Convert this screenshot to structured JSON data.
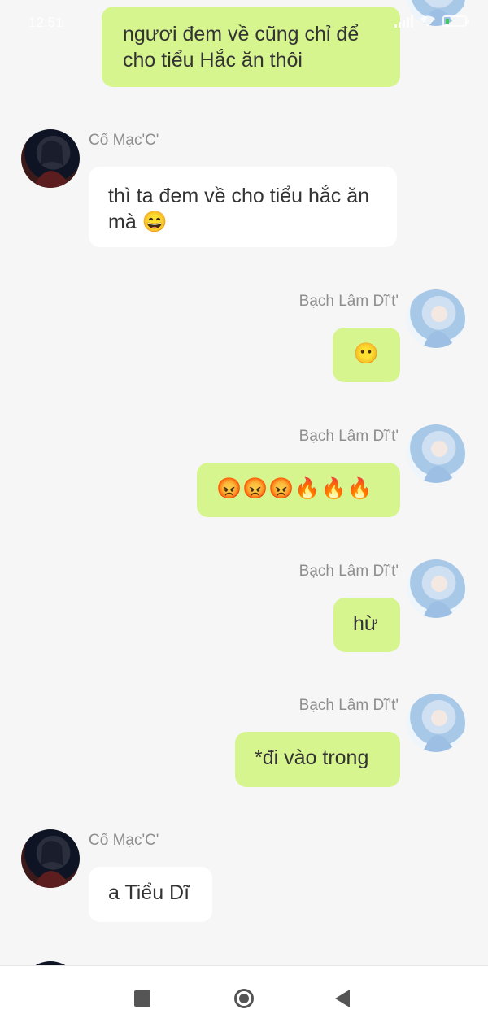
{
  "status_bar": {
    "time": "12:51",
    "icons": [
      "signal-icon",
      "wifi-icon",
      "battery-icon"
    ]
  },
  "participants": {
    "other": {
      "name": "Cố Mạc'C'",
      "avatar": "dark-haired-character-avatar"
    },
    "me": {
      "name": "Bạch Lâm Dĩ't'",
      "avatar": "white-haired-character-avatar"
    }
  },
  "messages": [
    {
      "from": "me",
      "show_name": false,
      "text": "ngươi đem về cũng chỉ để cho tiểu Hắc ăn thôi"
    },
    {
      "from": "other",
      "name": "Cố Mạc'C'",
      "text": "thì ta đem về cho tiểu hắc ăn mà 😄"
    },
    {
      "from": "me",
      "name": "Bạch Lâm Dĩ't'",
      "text": "😶"
    },
    {
      "from": "me",
      "name": "Bạch Lâm Dĩ't'",
      "text": "😡😡😡🔥🔥🔥"
    },
    {
      "from": "me",
      "name": "Bạch Lâm Dĩ't'",
      "text": "hừ"
    },
    {
      "from": "me",
      "name": "Bạch Lâm Dĩ't'",
      "text": "*đi vào trong"
    },
    {
      "from": "other",
      "name": "Cố Mạc'C'",
      "text": "a Tiểu Dĩ"
    }
  ],
  "colors": {
    "my_bubble": "#d7f58f",
    "their_bubble": "#ffffff",
    "background": "#f6f6f6",
    "name_text": "#8e8e8e"
  },
  "nav_bar": {
    "buttons": [
      "recent-apps-icon",
      "home-icon",
      "back-icon"
    ]
  }
}
